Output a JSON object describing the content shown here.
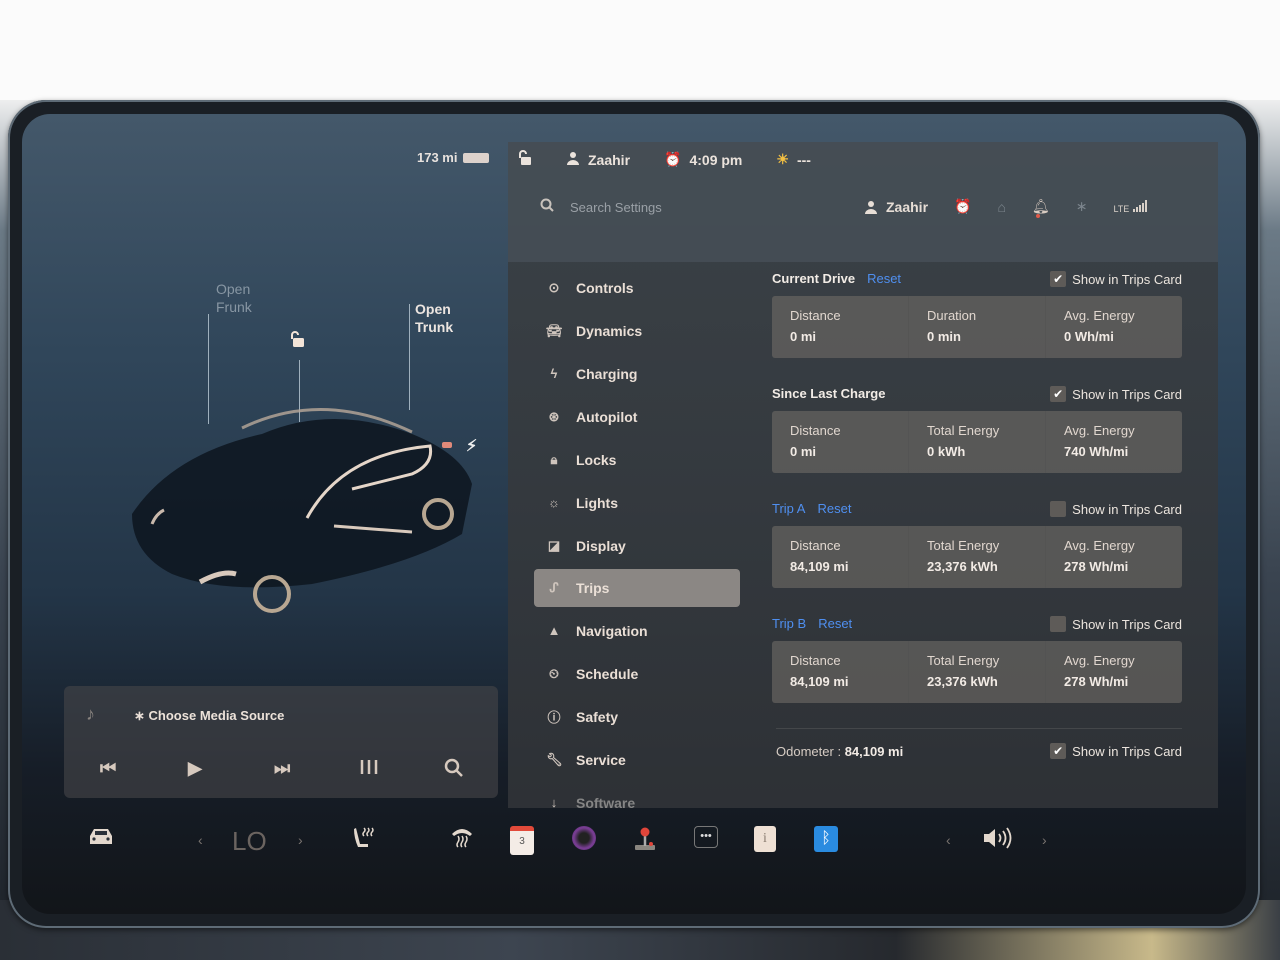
{
  "car_panel": {
    "range": "173 mi",
    "frunk_label_1": "Open",
    "frunk_label_2": "Frunk",
    "trunk_label_1": "Open",
    "trunk_label_2": "Trunk"
  },
  "media": {
    "source_label": "Choose Media Source",
    "bluetooth_glyph": "∗",
    "controls": [
      "previous",
      "play",
      "next",
      "equalizer",
      "search"
    ]
  },
  "status_bar": {
    "profile_name": "Zaahir",
    "time": "4:09 pm",
    "weather": "---"
  },
  "settings_header": {
    "search_placeholder": "Search Settings",
    "profile_name": "Zaahir",
    "network": "LTE"
  },
  "menu": [
    {
      "label": "Controls",
      "icon": "toggle-icon"
    },
    {
      "label": "Dynamics",
      "icon": "car-icon"
    },
    {
      "label": "Charging",
      "icon": "bolt-icon"
    },
    {
      "label": "Autopilot",
      "icon": "steering-wheel-icon"
    },
    {
      "label": "Locks",
      "icon": "lock-icon"
    },
    {
      "label": "Lights",
      "icon": "light-icon"
    },
    {
      "label": "Display",
      "icon": "display-icon"
    },
    {
      "label": "Trips",
      "icon": "trips-icon",
      "active": true
    },
    {
      "label": "Navigation",
      "icon": "navigation-icon"
    },
    {
      "label": "Schedule",
      "icon": "schedule-icon"
    },
    {
      "label": "Safety",
      "icon": "safety-icon"
    },
    {
      "label": "Service",
      "icon": "wrench-icon"
    },
    {
      "label": "Software",
      "icon": "download-icon"
    }
  ],
  "trips": {
    "current_drive": {
      "title": "Current Drive",
      "reset": "Reset",
      "show_in_card": "Show in Trips Card",
      "checked": true,
      "stats": [
        {
          "label": "Distance",
          "value": "0 mi"
        },
        {
          "label": "Duration",
          "value": "0 min"
        },
        {
          "label": "Avg. Energy",
          "value": "0 Wh/mi"
        }
      ]
    },
    "since_last_charge": {
      "title": "Since Last Charge",
      "show_in_card": "Show in Trips Card",
      "checked": true,
      "stats": [
        {
          "label": "Distance",
          "value": "0 mi"
        },
        {
          "label": "Total Energy",
          "value": "0 kWh"
        },
        {
          "label": "Avg. Energy",
          "value": "740 Wh/mi"
        }
      ]
    },
    "trip_a": {
      "title": "Trip A",
      "reset": "Reset",
      "show_in_card": "Show in Trips Card",
      "checked": false,
      "stats": [
        {
          "label": "Distance",
          "value": "84,109 mi"
        },
        {
          "label": "Total Energy",
          "value": "23,376 kWh"
        },
        {
          "label": "Avg. Energy",
          "value": "278 Wh/mi"
        }
      ]
    },
    "trip_b": {
      "title": "Trip B",
      "reset": "Reset",
      "show_in_card": "Show in Trips Card",
      "checked": false,
      "stats": [
        {
          "label": "Distance",
          "value": "84,109 mi"
        },
        {
          "label": "Total Energy",
          "value": "23,376 kWh"
        },
        {
          "label": "Avg. Energy",
          "value": "278 Wh/mi"
        }
      ]
    },
    "odometer": {
      "label": "Odometer",
      "separator": ":",
      "value": "84,109 mi",
      "show_in_card": "Show in Trips Card",
      "checked": true
    }
  },
  "dock": {
    "climate_temp": "LO",
    "calendar_day": "3",
    "dots_label": "•••",
    "info_label": "i"
  },
  "colors": {
    "accent_blue": "#4f8ff0",
    "alarm_orange": "#f0863a",
    "bluetooth_blue": "#2a8be0",
    "calendar_red": "#e24a3a"
  }
}
